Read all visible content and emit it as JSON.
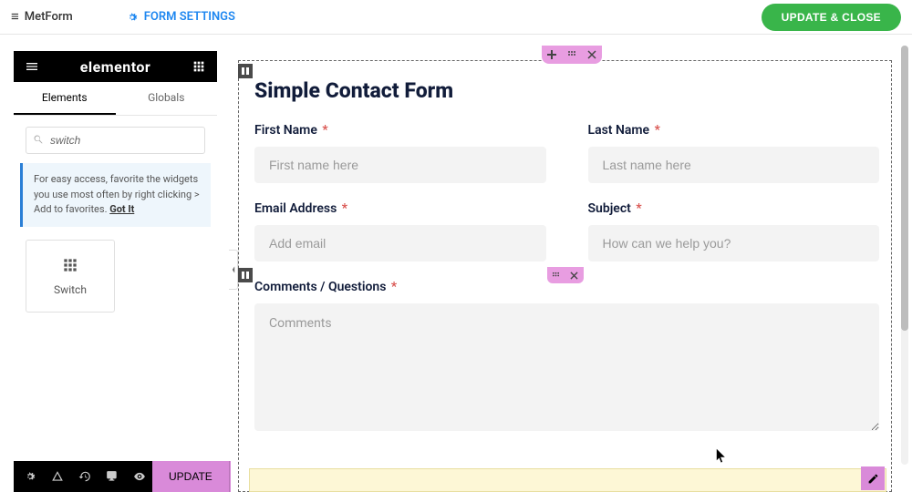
{
  "header": {
    "brand": "MetForm",
    "form_settings": "FORM SETTINGS",
    "update_close": "UPDATE & CLOSE"
  },
  "panel": {
    "logo": "elementor",
    "tabs": {
      "elements": "Elements",
      "globals": "Globals"
    },
    "search": {
      "value": "switch"
    },
    "tip": {
      "text": "For easy access, favorite the widgets you use most often by right clicking > Add to favorites.",
      "got_it": "Got It"
    },
    "widget": {
      "switch": "Switch"
    },
    "update_btn": "UPDATE"
  },
  "form": {
    "title": "Simple Contact Form",
    "first_name": {
      "label": "First Name",
      "placeholder": "First name here"
    },
    "last_name": {
      "label": "Last Name",
      "placeholder": "Last name here"
    },
    "email": {
      "label": "Email Address",
      "placeholder": "Add email"
    },
    "subject": {
      "label": "Subject",
      "placeholder": "How can we help you?"
    },
    "comments": {
      "label": "Comments / Questions",
      "placeholder": "Comments"
    },
    "required": "*"
  }
}
